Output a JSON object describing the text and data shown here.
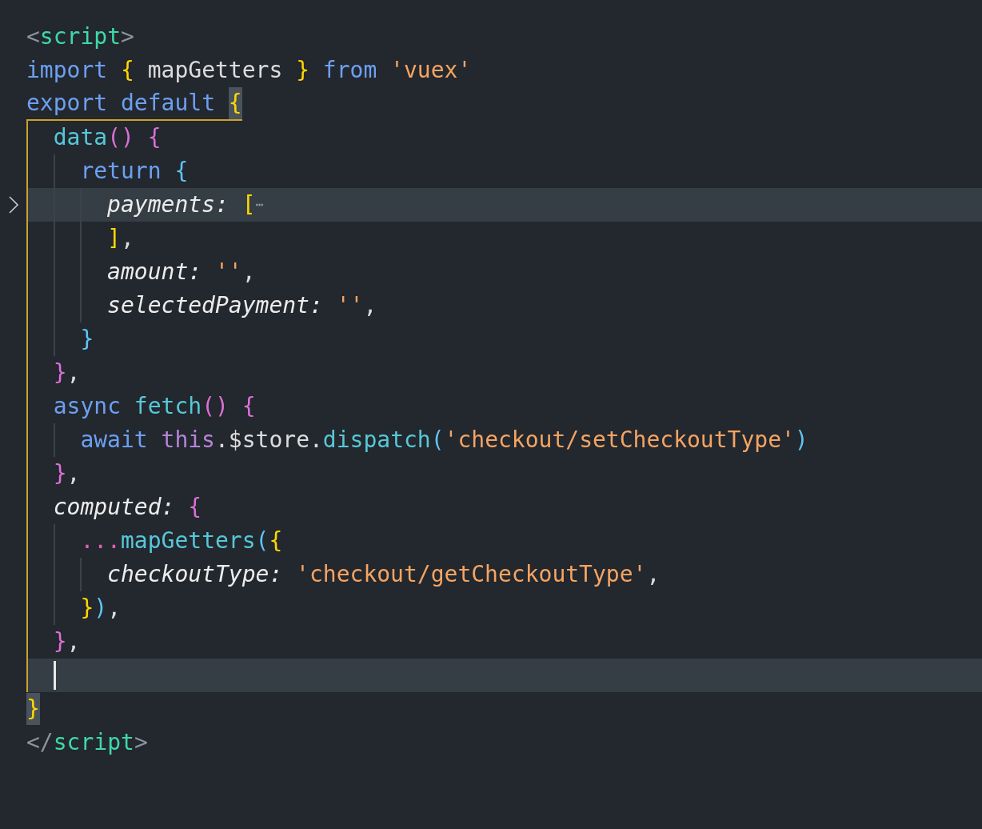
{
  "lines": [
    {
      "tokens": [
        {
          "text": "<",
          "kind": "tagp"
        },
        {
          "text": "script",
          "kind": "tag"
        },
        {
          "text": ">",
          "kind": "tagp"
        }
      ]
    },
    {
      "tokens": [
        {
          "text": "import",
          "kind": "keyword"
        },
        {
          "text": "{",
          "kind": "brace1",
          "gap": true
        },
        {
          "text": "mapGetters",
          "kind": "plain",
          "gap": true
        },
        {
          "text": "}",
          "kind": "brace1",
          "gap": true
        },
        {
          "text": "from",
          "kind": "keyword",
          "gap": true
        },
        {
          "text": "'vuex'",
          "kind": "string",
          "gap": true
        }
      ]
    },
    {
      "active": true,
      "tokens": [
        {
          "text": "export default",
          "kind": "keyword"
        },
        {
          "text": "{",
          "kind": "brace1",
          "matched": true,
          "gap": true
        }
      ],
      "children": [
        {
          "tokens": [
            {
              "text": "data",
              "kind": "func"
            },
            {
              "text": "()",
              "kind": "brace2"
            },
            {
              "text": "{",
              "kind": "brace2",
              "gap": true
            }
          ],
          "children": [
            {
              "tokens": [
                {
                  "text": "return",
                  "kind": "keyword"
                },
                {
                  "text": "{",
                  "kind": "brace3",
                  "gap": true
                }
              ],
              "children": [
                {
                  "folded": true,
                  "highlighted": true,
                  "tokens": [
                    {
                      "text": "payments:",
                      "kind": "prop"
                    },
                    {
                      "text": "[",
                      "kind": "brace1",
                      "gap": true
                    },
                    {
                      "text": "⋯",
                      "kind": "fold"
                    }
                  ]
                },
                {
                  "tokens": [
                    {
                      "text": "]",
                      "kind": "brace1"
                    },
                    {
                      "text": ",",
                      "kind": "plain"
                    }
                  ]
                },
                {
                  "tokens": [
                    {
                      "text": "amount:",
                      "kind": "prop"
                    },
                    {
                      "text": "''",
                      "kind": "string",
                      "gap": true
                    },
                    {
                      "text": ",",
                      "kind": "plain"
                    }
                  ]
                },
                {
                  "tokens": [
                    {
                      "text": "selectedPayment:",
                      "kind": "prop"
                    },
                    {
                      "text": "''",
                      "kind": "string",
                      "gap": true
                    },
                    {
                      "text": ",",
                      "kind": "plain"
                    }
                  ]
                }
              ]
            },
            {
              "tokens": [
                {
                  "text": "}",
                  "kind": "brace3"
                }
              ]
            }
          ]
        },
        {
          "tokens": [
            {
              "text": "}",
              "kind": "brace2"
            },
            {
              "text": ",",
              "kind": "plain"
            }
          ]
        },
        {
          "tokens": [
            {
              "text": "async",
              "kind": "keyword"
            },
            {
              "text": "fetch",
              "kind": "func",
              "gap": true
            },
            {
              "text": "()",
              "kind": "brace2"
            },
            {
              "text": "{",
              "kind": "brace2",
              "gap": true
            }
          ],
          "children": [
            {
              "tokens": [
                {
                  "text": "await",
                  "kind": "keyword"
                },
                {
                  "text": "this",
                  "kind": "this",
                  "gap": true
                },
                {
                  "text": ".$store.",
                  "kind": "plain"
                },
                {
                  "text": "dispatch",
                  "kind": "func"
                },
                {
                  "text": "(",
                  "kind": "brace3"
                },
                {
                  "text": "'checkout/setCheckoutType'",
                  "kind": "string"
                },
                {
                  "text": ")",
                  "kind": "brace3"
                }
              ]
            }
          ]
        },
        {
          "tokens": [
            {
              "text": "}",
              "kind": "brace2"
            },
            {
              "text": ",",
              "kind": "plain"
            }
          ]
        },
        {
          "tokens": [
            {
              "text": "computed:",
              "kind": "prop"
            },
            {
              "text": "{",
              "kind": "brace2",
              "gap": true
            }
          ],
          "children": [
            {
              "tokens": [
                {
                  "text": "...",
                  "kind": "spread"
                },
                {
                  "text": "mapGetters",
                  "kind": "func"
                },
                {
                  "text": "(",
                  "kind": "brace3"
                },
                {
                  "text": "{",
                  "kind": "brace1"
                }
              ],
              "children": [
                {
                  "tokens": [
                    {
                      "text": "checkoutType:",
                      "kind": "prop"
                    },
                    {
                      "text": "'checkout/getCheckoutType'",
                      "kind": "string",
                      "gap": true
                    },
                    {
                      "text": ",",
                      "kind": "plain"
                    }
                  ]
                }
              ]
            },
            {
              "tokens": [
                {
                  "text": "}",
                  "kind": "brace1"
                },
                {
                  "text": ")",
                  "kind": "brace3"
                },
                {
                  "text": ",",
                  "kind": "plain"
                }
              ]
            }
          ]
        },
        {
          "tokens": [
            {
              "text": "}",
              "kind": "brace2"
            },
            {
              "text": ",",
              "kind": "plain"
            }
          ]
        },
        {
          "current": true,
          "highlighted": true
        }
      ]
    },
    {
      "tokens": [
        {
          "text": "}",
          "kind": "brace1",
          "matched": true
        }
      ]
    },
    {
      "tokens": [
        {
          "text": "</",
          "kind": "tagp"
        },
        {
          "text": "script",
          "kind": "tag"
        },
        {
          "text": ">",
          "kind": "tagp"
        }
      ]
    }
  ]
}
